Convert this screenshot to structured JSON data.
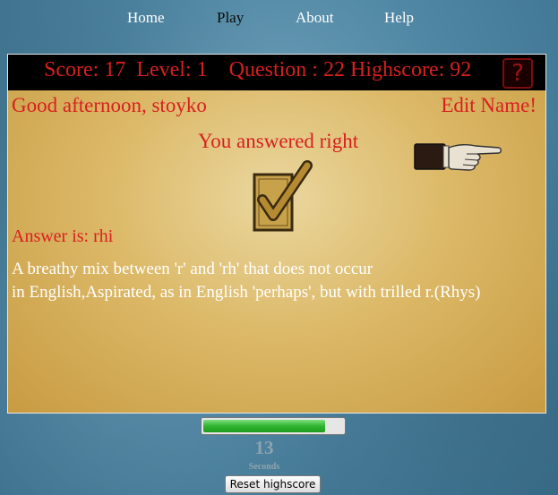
{
  "nav": {
    "items": [
      {
        "label": "Home"
      },
      {
        "label": "Play"
      },
      {
        "label": "About"
      },
      {
        "label": "Help"
      }
    ],
    "active": "Play"
  },
  "status": {
    "score_label": "Score:",
    "score": "17",
    "level_label": "Level:",
    "level": "1",
    "question_label": "Question :",
    "question": "22",
    "highscore_label": "Highscore:",
    "highscore": "92",
    "help_icon": "question-mark-icon"
  },
  "game": {
    "greeting": "Good afternoon, stoyko",
    "edit_name": "Edit Name!",
    "result": "You answered right",
    "answer": "Answer is: rhi",
    "description_line1": "A breathy mix between 'r' and 'rh' that does not occur",
    "description_line2": "in English,Aspirated, as in English 'perhaps', but with trilled r.(Rhys)",
    "next_icon": "pointing-hand-icon",
    "check_icon": "checkmark-icon"
  },
  "timer": {
    "progress_fraction": 0.87,
    "seconds": "13",
    "seconds_label": "Seconds"
  },
  "reset_button": "Reset highscore",
  "colors": {
    "accent_red": "#d81f1f",
    "status_bg": "#000000",
    "progress_green": "#2fb52f"
  }
}
